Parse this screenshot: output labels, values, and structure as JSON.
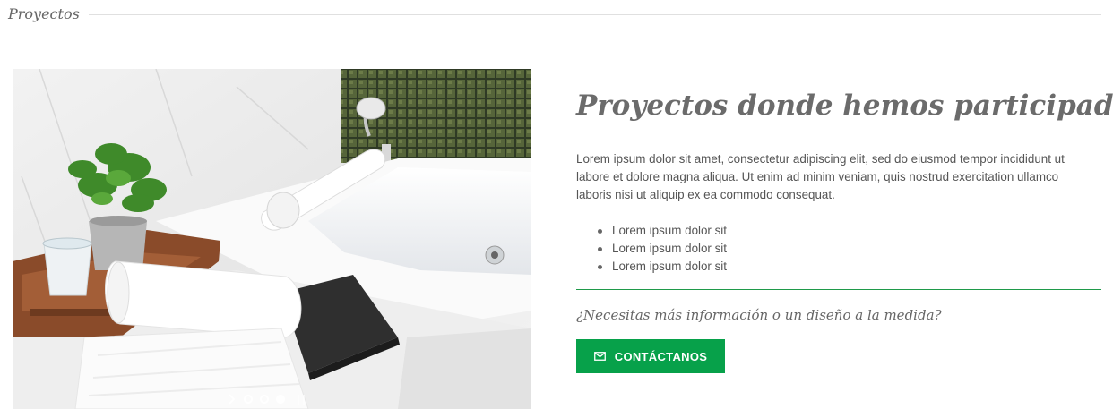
{
  "section": {
    "title": "Proyectos"
  },
  "slider": {
    "image_alt": "Baño con bañera blanca, toallas y planta",
    "slides_count": 3,
    "active_slide": 3,
    "icons": {
      "next": "chevron-right-icon",
      "pause": "pause-icon"
    }
  },
  "content": {
    "headline": "Proyectos donde hemos participado",
    "paragraph": "Lorem ipsum dolor sit amet, consectetur adipiscing elit, sed do eiusmod tempor incididunt ut labore et dolore magna aliqua. Ut enim ad minim veniam, quis nostrud exercitation ullamco laboris nisi ut aliquip ex ea commodo consequat.",
    "bullets": [
      "Lorem ipsum dolor sit",
      "Lorem ipsum dolor sit",
      "Lorem ipsum dolor sit"
    ],
    "cta_question": "¿Necesitas más información o un diseño a la medida?",
    "cta_button": {
      "label": "CONTÁCTANOS",
      "icon": "mail-icon",
      "color": "#07a14a"
    }
  },
  "colors": {
    "accent": "#07a14a",
    "rule": "#1f9a4a",
    "text": "#555555",
    "heading": "#6b6b6b"
  }
}
